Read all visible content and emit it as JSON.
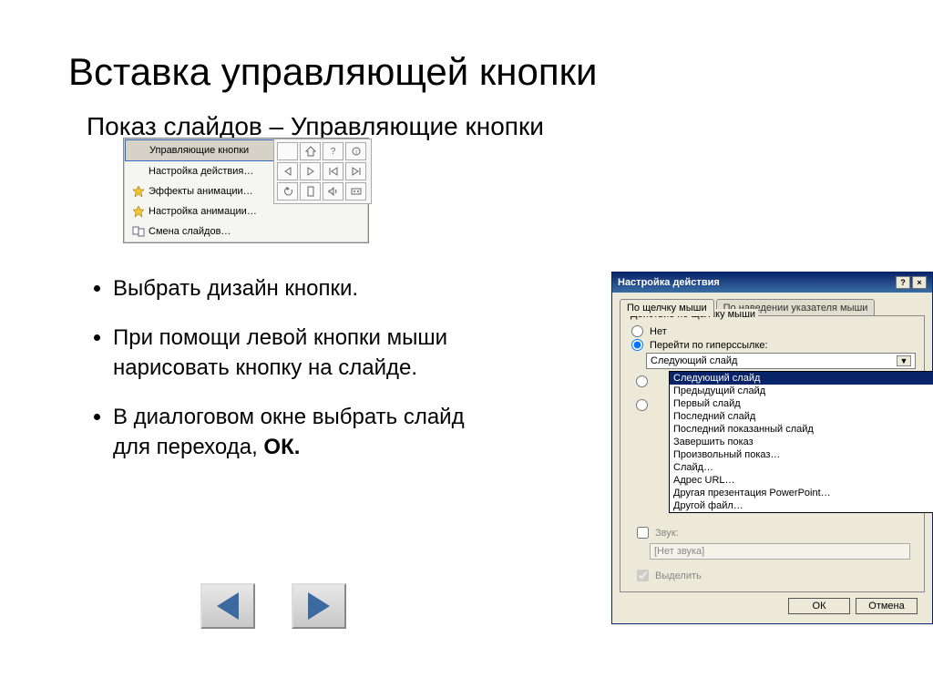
{
  "title": "Вставка управляющей кнопки",
  "subtitle": "Показ слайдов – Управляющие кнопки",
  "bullets": {
    "b1": "Выбрать дизайн кнопки.",
    "b2": "При помощи левой кнопки мыши нарисовать кнопку на слайде.",
    "b3_pre": "В диалоговом окне выбрать слайд для перехода, ",
    "b3_ok": "ОК."
  },
  "menu": {
    "items": [
      {
        "label": "Управляющие кнопки",
        "arrow": "▶",
        "hl": true
      },
      {
        "label": "Настройка действия…",
        "arrow": "",
        "hl": false
      },
      {
        "label": "Эффекты анимации…",
        "arrow": "",
        "hl": false
      },
      {
        "label": "Настройка анимации…",
        "arrow": "",
        "hl": false
      },
      {
        "label": "Смена слайдов…",
        "arrow": "",
        "hl": false
      }
    ]
  },
  "dialog": {
    "title": "Настройка действия",
    "tabs": {
      "active": "По щелчку мыши",
      "inactive": "По наведении указателя мыши"
    },
    "group_label": "Действие по щелчку мыши",
    "radio_none": "Нет",
    "radio_link": "Перейти по гиперссылке:",
    "combo_value": "Следующий слайд",
    "dropdown_items": [
      "Следующий слайд",
      "Предыдущий слайд",
      "Первый слайд",
      "Последний слайд",
      "Последний показанный слайд",
      "Завершить показ",
      "Произвольный показ…",
      "Слайд…",
      "Адрес URL…",
      "Другая презентация PowerPoint…",
      "Другой файл…"
    ],
    "chk_sound": "Звук:",
    "sound_value": "[Нет звука]",
    "chk_highlight": "Выделить",
    "btn_ok": "ОК",
    "btn_cancel": "Отмена"
  }
}
